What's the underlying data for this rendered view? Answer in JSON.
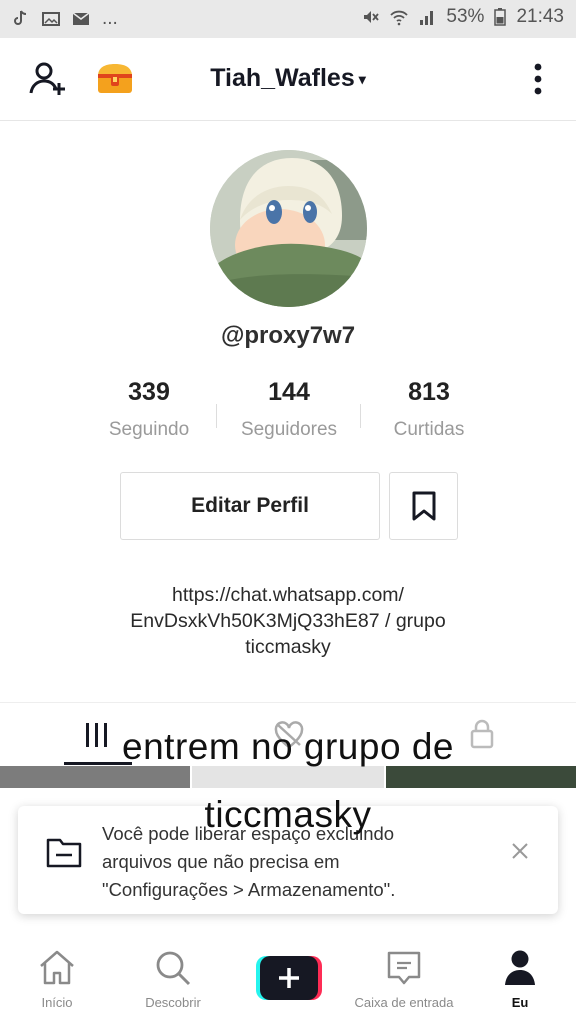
{
  "status_bar": {
    "battery": "53%",
    "time": "21:43",
    "ellipsis": "..."
  },
  "nav": {
    "username": "Tiah_Wafles",
    "caret": "▾"
  },
  "profile": {
    "handle": "@proxy7w7",
    "stats": [
      {
        "value": "339",
        "label": "Seguindo"
      },
      {
        "value": "144",
        "label": "Seguidores"
      },
      {
        "value": "813",
        "label": "Curtidas"
      }
    ],
    "edit_button": "Editar Perfil",
    "bio_lines": [
      "https://chat.whatsapp.com/",
      "EnvDsxkVh50K3MjQ33hE87 / grupo",
      "ticcmasky"
    ]
  },
  "overlay_caption": {
    "line1": "entrem no grupo de",
    "line2": "ticcmasky"
  },
  "toast": {
    "lines": [
      "Você pode liberar espaço excluindo",
      "arquivos que não precisa em",
      "\"Configurações > Armazenamento\"."
    ]
  },
  "bottom_nav": [
    {
      "label": "Início",
      "icon": "home-icon"
    },
    {
      "label": "Descobrir",
      "icon": "search-icon"
    },
    {
      "label": "",
      "icon": "plus-icon"
    },
    {
      "label": "Caixa de entrada",
      "icon": "inbox-icon"
    },
    {
      "label": "Eu",
      "icon": "profile-icon"
    }
  ],
  "colors": {
    "cyan": "#25f4ee",
    "red": "#fe2c55",
    "dark": "#161823"
  }
}
